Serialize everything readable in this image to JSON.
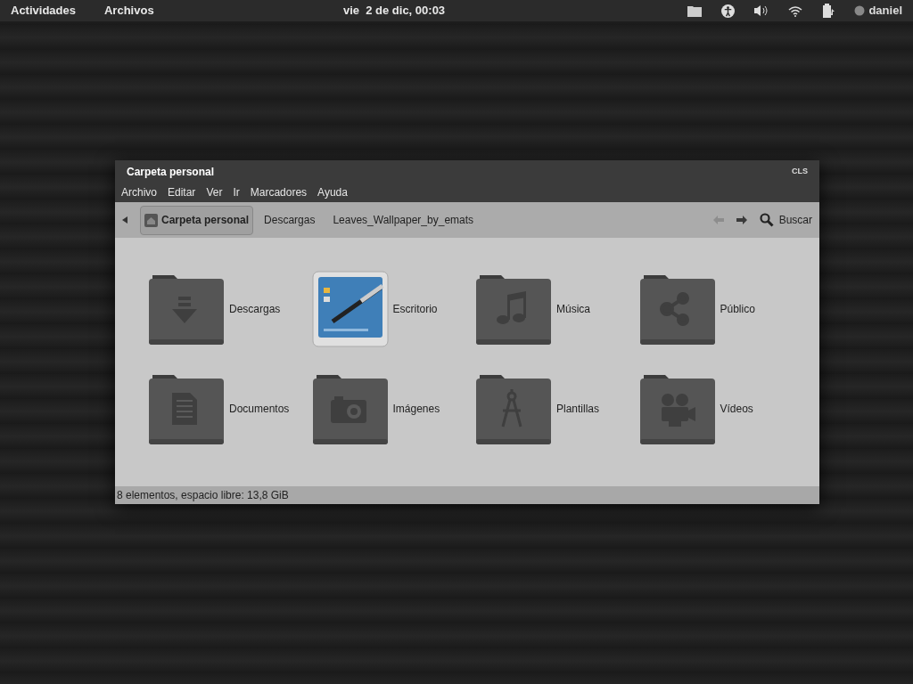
{
  "top_bar": {
    "activities": "Actividades",
    "app": "Archivos",
    "clock": "vie  2 de dic, 00:03",
    "user": "daniel"
  },
  "window": {
    "title": "Carpeta personal",
    "close": "CLS",
    "menu": [
      "Archivo",
      "Editar",
      "Ver",
      "Ir",
      "Marcadores",
      "Ayuda"
    ],
    "path": [
      {
        "label": "Carpeta personal",
        "selected": true
      },
      {
        "label": "Descargas",
        "selected": false
      },
      {
        "label": "Leaves_Wallpaper_by_emats",
        "selected": false
      }
    ],
    "nav": [
      {
        "kind": "back",
        "disabled": true
      },
      {
        "kind": "forward",
        "disabled": false
      }
    ],
    "search": "Buscar",
    "items": [
      {
        "name": "Descargas",
        "kind": "download"
      },
      {
        "name": "Escritorio",
        "kind": "desktop"
      },
      {
        "name": "Música",
        "kind": "music"
      },
      {
        "name": "Público",
        "kind": "share"
      },
      {
        "name": "Documentos",
        "kind": "document"
      },
      {
        "name": "Imágenes",
        "kind": "camera"
      },
      {
        "name": "Plantillas",
        "kind": "compass"
      },
      {
        "name": "Vídeos",
        "kind": "film"
      }
    ],
    "status": "8 elementos, espacio libre: 13,8 GiB"
  }
}
